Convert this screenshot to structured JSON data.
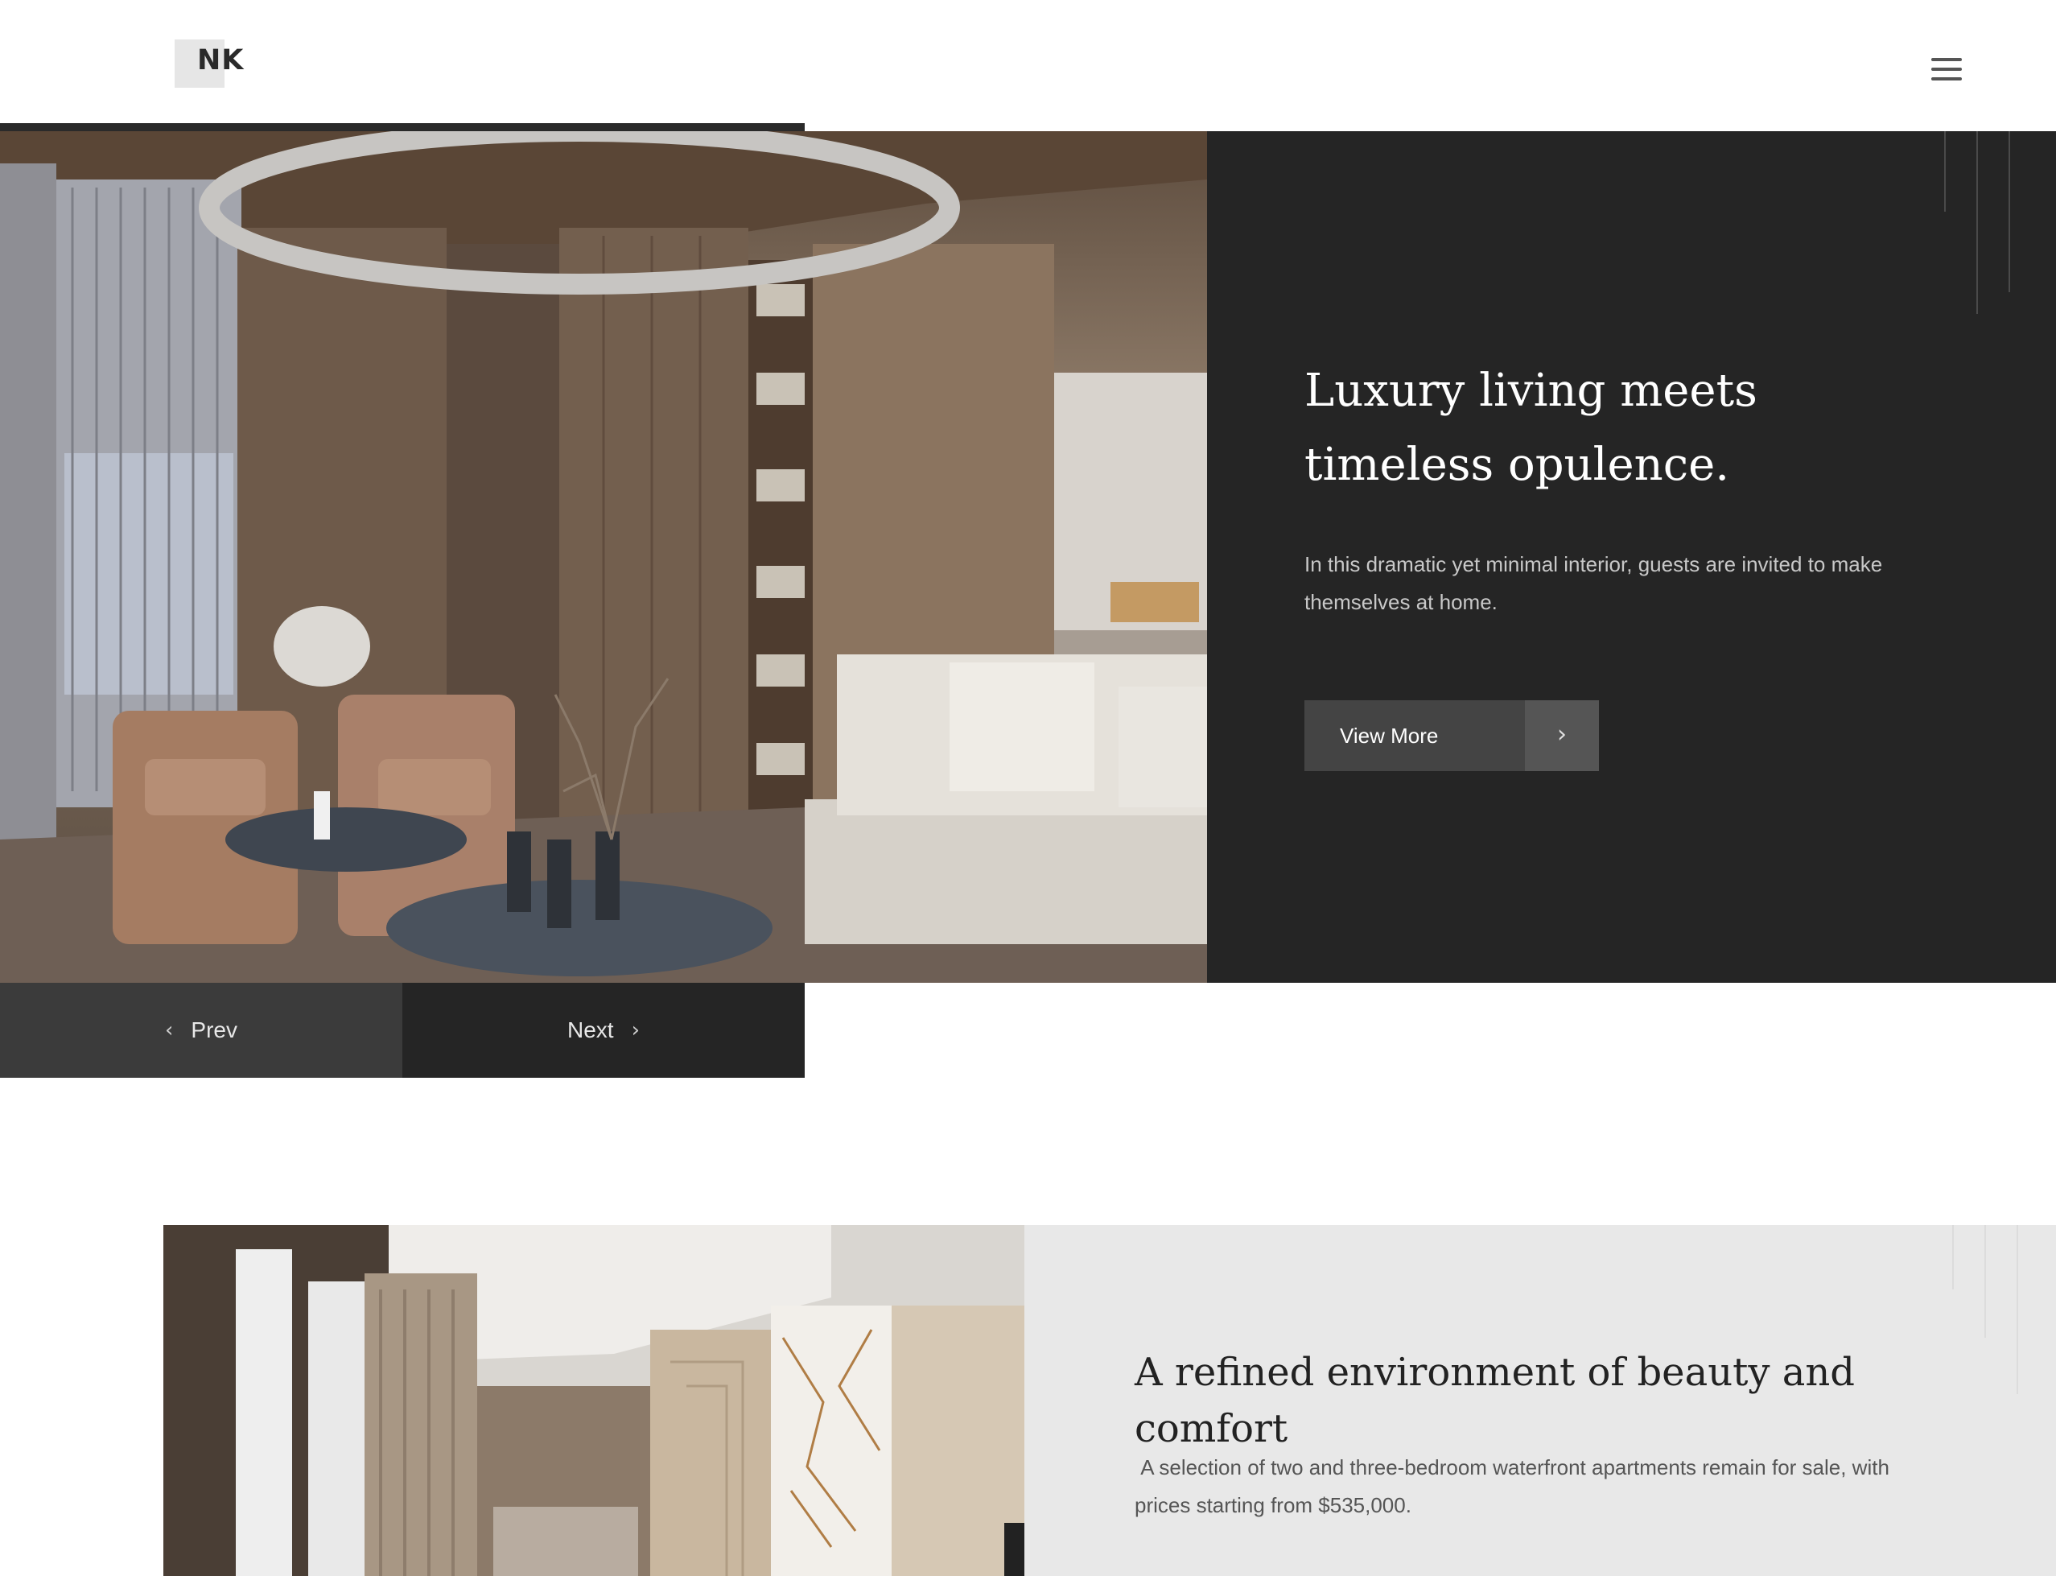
{
  "header": {
    "logo_text": "NK",
    "menu_icon": "hamburger-menu-icon"
  },
  "hero": {
    "title": "Luxury living meets timeless opulence.",
    "description": "In this dramatic yet minimal interior, guests are invited to make themselves at home.",
    "button_label": "View More",
    "button_icon": "chevron-right-icon",
    "image_subject": "living-room-interior"
  },
  "slider": {
    "prev_label": "Prev",
    "next_label": "Next",
    "prev_icon": "chevron-left-icon",
    "next_icon": "chevron-right-icon"
  },
  "section2": {
    "title": "A refined environment of beauty and comfort",
    "description": " A selection of two and three-bedroom waterfront apartments remain for sale, with prices starting from $535,000.",
    "image_subject": "kitchen-interior"
  },
  "colors": {
    "dark_panel": "#252525",
    "light_panel": "#e8e8e8",
    "button_bg": "#444444",
    "prev_bg": "#3b3b3b"
  }
}
